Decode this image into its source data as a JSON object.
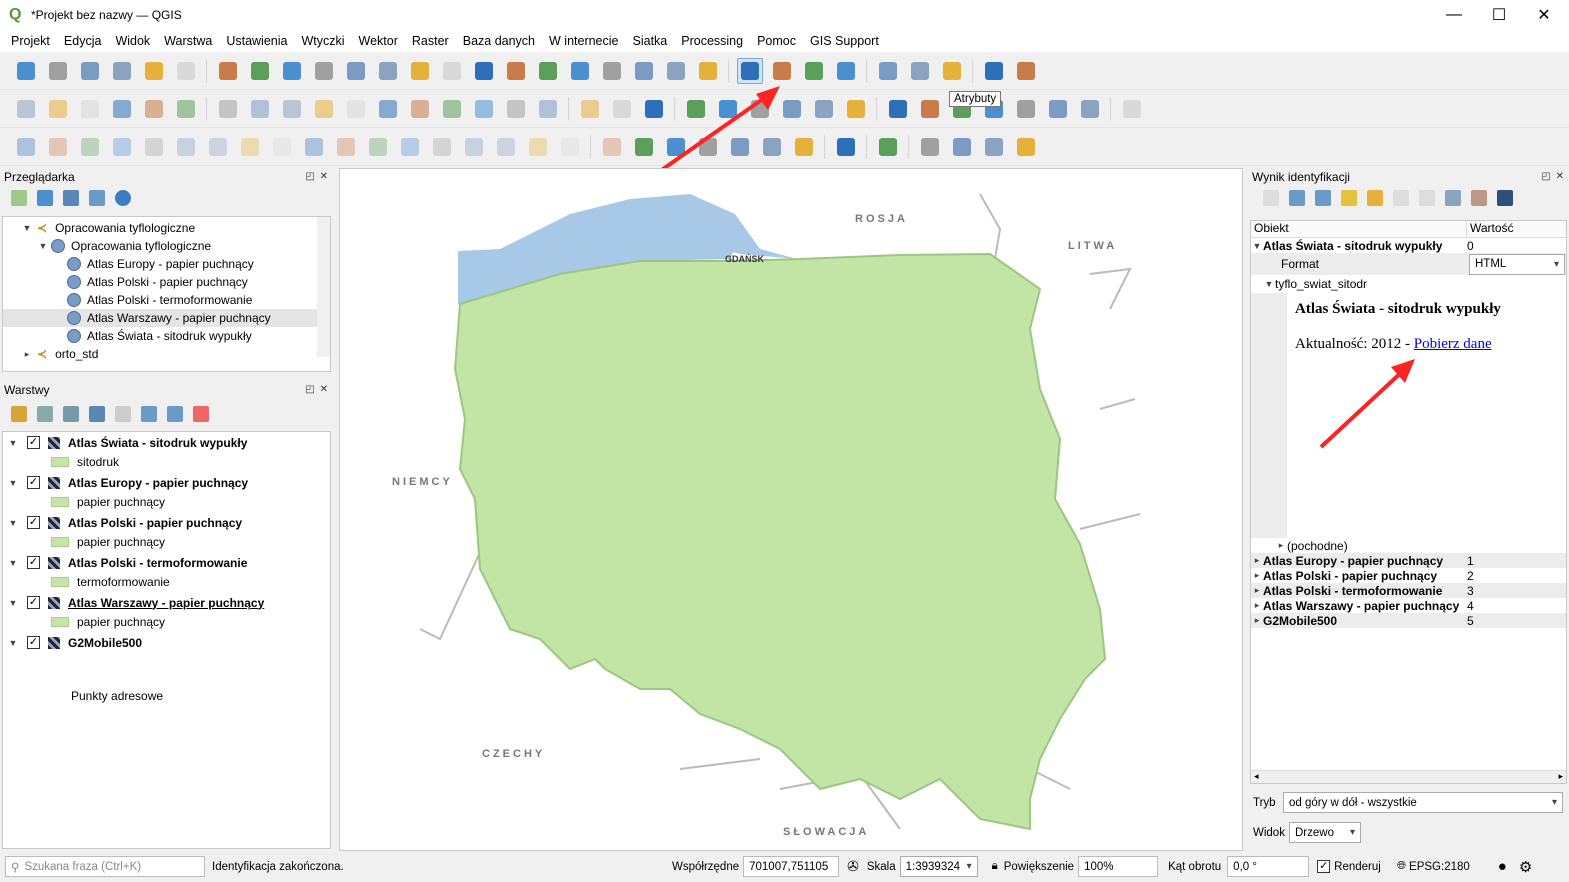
{
  "window": {
    "title": "*Projekt bez nazwy — QGIS",
    "minimize": "—",
    "maximize": "☐",
    "close": "✕"
  },
  "menu": [
    "Projekt",
    "Edycja",
    "Widok",
    "Warstwa",
    "Ustawienia",
    "Wtyczki",
    "Wektor",
    "Raster",
    "Baza danych",
    "W internecie",
    "Siatka",
    "Processing",
    "Pomoc",
    "GIS Support"
  ],
  "toolbars": {
    "row1": [
      "new-project",
      "open-project",
      "save-project",
      "save-as",
      "print-layout",
      "style-manager",
      "sep",
      "pan",
      "pan-to-selection",
      "zoom-in",
      "zoom-out",
      "zoom-full",
      "zoom-to-selection",
      "zoom-to-layer",
      "zoom-native",
      "zoom-last",
      "zoom-next",
      "new-bookmark",
      "show-bookmarks",
      "decorations",
      "map-tips",
      "temporal",
      "refresh",
      "sep",
      "identify",
      "attribute-table",
      "settings-cog",
      "statistics",
      "sep",
      "open-table",
      "measure",
      "annotation",
      "sep",
      "locate",
      "text-annotation"
    ],
    "row2": [
      "add-vector",
      "add-raster",
      "digitize",
      "edit",
      "wms",
      "new-layer",
      "sep",
      "toggle-edit",
      "pencil",
      "save-edits",
      "add-feature",
      "vertex",
      "delete",
      "cut",
      "copy",
      "paste",
      "undo",
      "redo",
      "sep",
      "label",
      "label-pin",
      "label-abc",
      "sep",
      "label-move",
      "label-rotate",
      "label-change",
      "label-show",
      "tooltip-slot",
      "binoculars",
      "sep",
      "python",
      "plugin1",
      "plugin2",
      "plugin3",
      "plugin4",
      "grid",
      "globe",
      "sep",
      "help"
    ],
    "row3": [
      "ruler",
      "select-rect",
      "select-points",
      "node",
      "node2",
      "node3",
      "node4",
      "node5",
      "node6",
      "node7",
      "node8",
      "node9",
      "node10",
      "node11",
      "node12",
      "node13",
      "node14",
      "node15",
      "sep",
      "grid-tool",
      "locate-tool",
      "nmt",
      "layers-tool",
      "wmts",
      "globe-tool",
      "service",
      "sep",
      "map-plus",
      "sep",
      "download",
      "sep",
      "select-tool",
      "tool2",
      "tool3",
      "tool4"
    ]
  },
  "tooltip": "Atrybuty",
  "browser": {
    "title": "Przeglądarka",
    "items": [
      {
        "label": "Opracowania tyflologiczne",
        "level": 0,
        "expanded": true,
        "icon": "connection"
      },
      {
        "label": "Opracowania tyflologiczne",
        "level": 1,
        "expanded": true,
        "icon": "globe"
      },
      {
        "label": "Atlas Europy - papier puchnący",
        "level": 2,
        "icon": "globe"
      },
      {
        "label": "Atlas Polski - papier puchnący",
        "level": 2,
        "icon": "globe"
      },
      {
        "label": "Atlas Polski - termoformowanie",
        "level": 2,
        "icon": "globe"
      },
      {
        "label": "Atlas Warszawy - papier puchnący",
        "level": 2,
        "icon": "globe",
        "selected": true
      },
      {
        "label": "Atlas Świata - sitodruk wypukły",
        "level": 2,
        "icon": "globe"
      },
      {
        "label": "orto_std",
        "level": 0,
        "expanded": false,
        "icon": "connection"
      }
    ]
  },
  "layers": {
    "title": "Warstwy",
    "items": [
      {
        "name": "Atlas Świata - sitodruk wypukły",
        "legend": "sitodruk"
      },
      {
        "name": "Atlas Europy - papier puchnący",
        "legend": "papier puchnący"
      },
      {
        "name": "Atlas Polski - papier puchnący",
        "legend": "papier puchnący"
      },
      {
        "name": "Atlas Polski - termoformowanie",
        "legend": "termoformowanie"
      },
      {
        "name": "Atlas Warszawy - papier puchnący",
        "legend": "papier puchnący",
        "underline": true
      },
      {
        "name": "G2Mobile500",
        "legend": null
      }
    ],
    "extra": "Punkty adresowe"
  },
  "map": {
    "labels": {
      "rosja": "ROSJA",
      "litwa": "LITWA",
      "niemcy": "NIEMCY",
      "czechy": "CZECHY",
      "slowacja": "SŁOWACJA",
      "gdansk": "GDAŃSK",
      "sz": "S"
    },
    "colors": {
      "land": "#c2e4a4",
      "border": "#9cc781",
      "sea": "#a8c8e8"
    }
  },
  "identify": {
    "title": "Wynik identyfikacji",
    "col_object": "Obiekt",
    "col_value": "Wartość",
    "top": {
      "name": "Atlas Świata - sitodruk wypukły",
      "value": "0"
    },
    "format_label": "Format",
    "format_value": "HTML",
    "sublayer": "tyflo_swiat_sitodr",
    "html_title": "Atlas Świata - sitodruk wypukły",
    "html_text": "Aktualność: 2012 - ",
    "html_link": "Pobierz dane",
    "derived": "(pochodne)",
    "others": [
      {
        "name": "Atlas Europy - papier puchnący",
        "value": "1"
      },
      {
        "name": "Atlas Polski - papier puchnący",
        "value": "2"
      },
      {
        "name": "Atlas Polski - termoformowanie",
        "value": "3"
      },
      {
        "name": "Atlas Warszawy - papier puchnący",
        "value": "4"
      },
      {
        "name": "G2Mobile500",
        "value": "5"
      }
    ],
    "mode_label": "Tryb",
    "mode_value": "od góry w dół - wszystkie",
    "view_label": "Widok",
    "view_value": "Drzewo"
  },
  "status": {
    "search_placeholder": "Szukana fraza (Ctrl+K)",
    "message": "Identyfikacja zakończona.",
    "coord_label": "Współrzędne",
    "coord_value": "701007,751105",
    "scale_label": "Skala",
    "scale_value": "1:3939324",
    "magnifier_label": "Powiększenie",
    "magnifier_value": "100%",
    "rotation_label": "Kąt obrotu",
    "rotation_value": "0,0 °",
    "render_label": "Renderuj",
    "render_checked": true,
    "crs": "EPSG:2180"
  }
}
